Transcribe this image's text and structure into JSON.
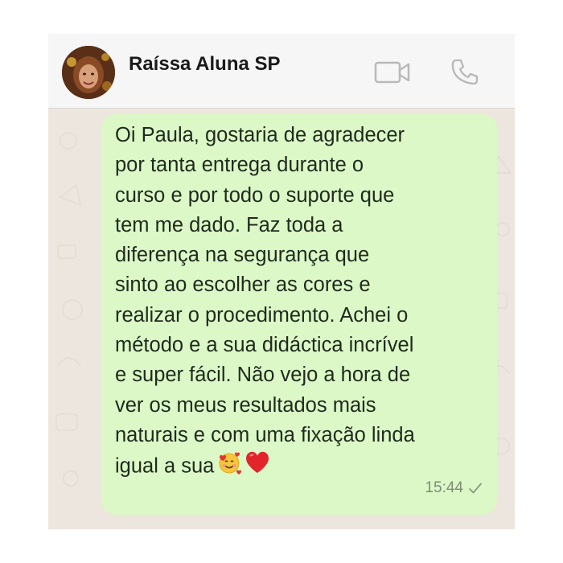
{
  "header": {
    "contact_name": "Raíssa Aluna SP",
    "avatar_icon": "contact-photo",
    "video_icon": "video-camera-icon",
    "call_icon": "phone-icon"
  },
  "message": {
    "text": "Oi Paula, gostaria de agradecer\npor tanta entrega durante o\ncurso e por todo o suporte que\ntem me dado. Faz toda a\ndiferença na segurança que\nsinto ao escolher as cores e\nrealizar o procedimento. Achei o\nmétodo e a sua didáctica incrível\ne super fácil. Não vejo a hora de\nver os meus resultados mais\nnaturais e com uma fixação linda\nigual a sua",
    "emojis": [
      "smiling-face-with-hearts",
      "red-heart"
    ],
    "time": "15:44",
    "status_icon": "single-check-icon"
  },
  "colors": {
    "bubble": "#dcf8c6",
    "header": "#f6f6f6",
    "chat_background": "#ece6df"
  }
}
